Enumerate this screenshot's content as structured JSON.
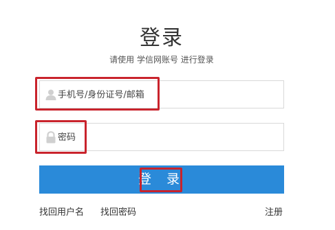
{
  "header": {
    "title": "登录",
    "subtitle": "请使用 学信网账号 进行登录"
  },
  "form": {
    "username_placeholder": "手机号/身份证号/邮箱",
    "username_value": "",
    "password_placeholder": "密码",
    "password_value": "",
    "username_icon": "user-icon",
    "password_icon": "lock-icon"
  },
  "actions": {
    "login_label": "登 录"
  },
  "links": {
    "find_username": "找回用户名",
    "find_password": "找回密码",
    "register": "注册"
  },
  "colors": {
    "primary": "#2a8ad9",
    "highlight": "#c9232c",
    "border": "#d8d8d8"
  }
}
